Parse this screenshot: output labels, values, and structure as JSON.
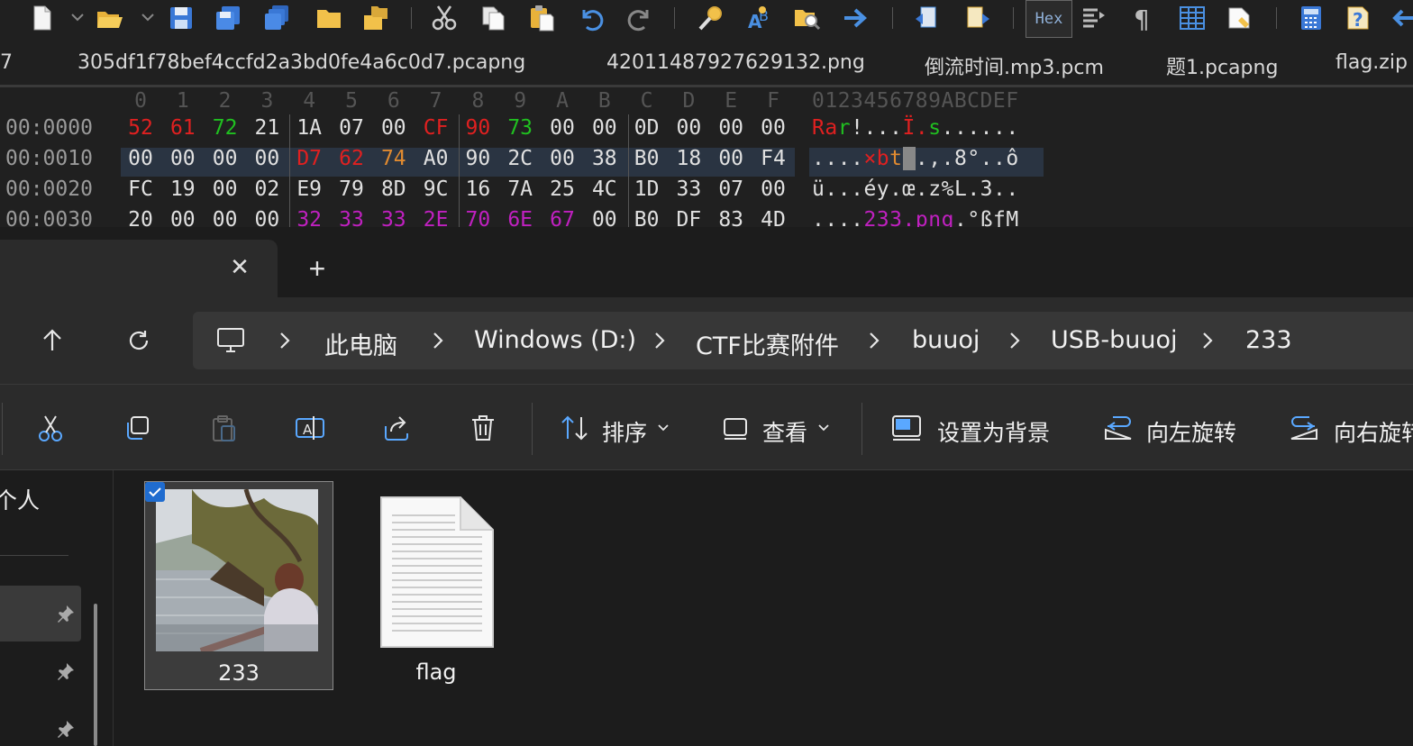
{
  "hex_editor": {
    "toolbar": {
      "icons": [
        "new-file-icon",
        "open-folder-icon",
        "save-icon",
        "save-all-icon",
        "save-copy-icon",
        "folder-icon",
        "folder-multi-icon",
        "cut-icon",
        "copy-icon",
        "paste-icon",
        "undo-icon",
        "redo-icon",
        "find-icon",
        "replace-icon",
        "find-in-files-icon",
        "goto-icon",
        "prev-block-icon",
        "next-block-icon",
        "hex-mode-icon",
        "compare-icon",
        "paragraph-icon",
        "columns-icon",
        "edit-highlight-icon",
        "calculator-icon",
        "help-icon",
        "back-icon"
      ],
      "hex_button_label": "Hex"
    },
    "tabs": [
      "7",
      "305df1f78bef4ccfd2a3bd0fe4a6c0d7.pcapng",
      "42011487927629132.png",
      "倒流时间.mp3.pcm",
      "题1.pcapng",
      "flag.zip"
    ],
    "column_headers": [
      "0",
      "1",
      "2",
      "3",
      "4",
      "5",
      "6",
      "7",
      "8",
      "9",
      "A",
      "B",
      "C",
      "D",
      "E",
      "F"
    ],
    "ascii_header": "0123456789ABCDEF",
    "rows": [
      {
        "offset": "00:0000",
        "bytes": [
          "52",
          "61",
          "72",
          "21",
          "1A",
          "07",
          "00",
          "CF",
          "90",
          "73",
          "00",
          "00",
          "0D",
          "00",
          "00",
          "00"
        ],
        "ascii": "Rar!...Ï.s......"
      },
      {
        "offset": "00:0010",
        "bytes": [
          "00",
          "00",
          "00",
          "00",
          "D7",
          "62",
          "74",
          "A0",
          "90",
          "2C",
          "00",
          "38",
          "B0",
          "18",
          "00",
          "F4"
        ],
        "ascii": "....×bt .,.8°..ô"
      },
      {
        "offset": "00:0020",
        "bytes": [
          "FC",
          "19",
          "00",
          "02",
          "E9",
          "79",
          "8D",
          "9C",
          "16",
          "7A",
          "25",
          "4C",
          "1D",
          "33",
          "07",
          "00"
        ],
        "ascii": "ü...éy.œ.z%L.3.."
      },
      {
        "offset": "00:0030",
        "bytes": [
          "20",
          "00",
          "00",
          "00",
          "32",
          "33",
          "33",
          "2E",
          "70",
          "6E",
          "67",
          "00",
          "B0",
          "DF",
          "83",
          "4D"
        ],
        "ascii": "....233.png.°ßƒM"
      }
    ],
    "colors": {
      "red": "#e02020",
      "green": "#20c020",
      "orange": "#e08a30",
      "purple": "#c020c0",
      "normal": "#e0e0e0"
    }
  },
  "explorer": {
    "tab": {
      "close_label": "✕",
      "new_tab_label": "+"
    },
    "nav": {
      "up_icon": "arrow-up-icon",
      "refresh_icon": "refresh-icon"
    },
    "breadcrumbs": [
      "此电脑",
      "Windows (D:)",
      "CTF比赛附件",
      "buuoj",
      "USB-buuoj",
      "233"
    ],
    "commands": {
      "sort_label": "排序",
      "view_label": "查看",
      "set_bg_label": "设置为背景",
      "rotate_left_label": "向左旋转",
      "rotate_right_label": "向右旋转"
    },
    "sidebar": {
      "personal_label": "个人"
    },
    "files": [
      {
        "name": "233",
        "type": "image",
        "selected": true
      },
      {
        "name": "flag",
        "type": "text-document",
        "selected": false
      }
    ]
  }
}
